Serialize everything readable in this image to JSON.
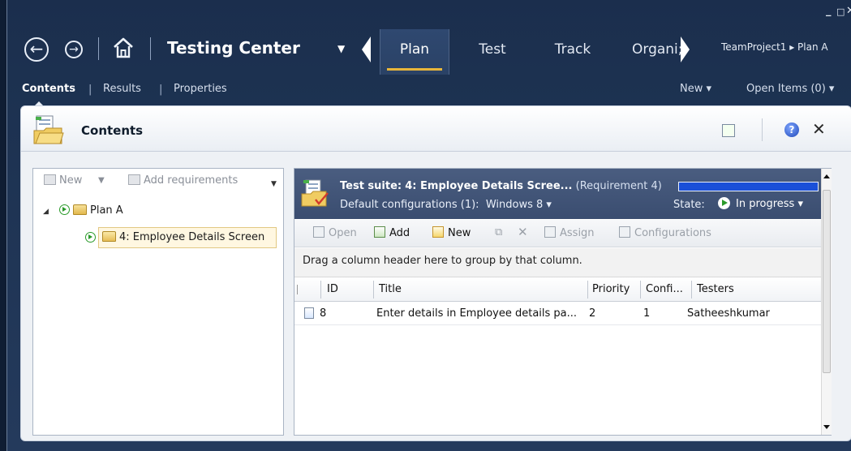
{
  "window": {
    "controls": {
      "minimize": "_",
      "maximize": "□",
      "close": "✕"
    }
  },
  "header": {
    "app_title": "Testing Center",
    "tabs": [
      {
        "label": "Plan",
        "active": true
      },
      {
        "label": "Test",
        "active": false
      },
      {
        "label": "Track",
        "active": false
      },
      {
        "label": "Organi;",
        "active": false
      }
    ],
    "breadcrumb": "TeamProject1 ▸ Plan A"
  },
  "subnav": {
    "items": [
      {
        "label": "Contents",
        "active": true
      },
      {
        "label": "Results",
        "active": false
      },
      {
        "label": "Properties",
        "active": false
      }
    ],
    "new_label": "New ▾",
    "open_items_label": "Open Items (0) ▾"
  },
  "panel": {
    "title": "Contents"
  },
  "tree": {
    "toolbar": {
      "new_label": "New",
      "add_req_label": "Add requirements"
    },
    "items": [
      {
        "label": "Plan A",
        "level": 0
      },
      {
        "label": "4: Employee Details Screen",
        "level": 1,
        "selected": true
      }
    ]
  },
  "suite": {
    "title_prefix": "Test suite:",
    "title": "4: Employee Details Scree...",
    "requirement": "(Requirement 4)",
    "progress": 1.0,
    "config_label": "Default configurations (1):",
    "config_value": "Windows 8 ▾",
    "state_label": "State:",
    "state_value": "In progress ▾"
  },
  "actions": {
    "open": "Open",
    "add": "Add",
    "new": "New",
    "assign": "Assign",
    "configurations": "Configurations"
  },
  "grid": {
    "group_hint": "Drag a column header here to group by that column.",
    "columns": [
      "ID",
      "Title",
      "Priority",
      "Confi...",
      "Testers"
    ],
    "rows": [
      {
        "id": "8",
        "title": "Enter details in Employee details pa...",
        "priority": "2",
        "config": "1",
        "testers": "Satheeshkumar"
      }
    ]
  },
  "colors": {
    "window_bg": "#1c3150",
    "active_tab_underline": "#e8b63a",
    "suite_header_bg": "#4a5d80",
    "progress_fill": "#1a4fd8",
    "play_green": "#2a9a2a"
  }
}
